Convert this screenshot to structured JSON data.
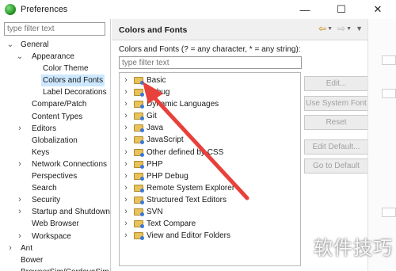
{
  "window": {
    "title": "Preferences",
    "controls": [
      "—",
      "☐",
      "✕"
    ]
  },
  "left": {
    "filter_placeholder": "type filter text",
    "tree": [
      {
        "label": "General",
        "level": 0,
        "state": "expanded"
      },
      {
        "label": "Appearance",
        "level": 1,
        "state": "expanded"
      },
      {
        "label": "Color Theme",
        "level": 2,
        "state": "leaf"
      },
      {
        "label": "Colors and Fonts",
        "level": 2,
        "state": "leaf",
        "selected": true
      },
      {
        "label": "Label Decorations",
        "level": 2,
        "state": "leaf"
      },
      {
        "label": "Compare/Patch",
        "level": 1,
        "state": "leaf"
      },
      {
        "label": "Content Types",
        "level": 1,
        "state": "leaf"
      },
      {
        "label": "Editors",
        "level": 1,
        "state": "collapsed"
      },
      {
        "label": "Globalization",
        "level": 1,
        "state": "leaf"
      },
      {
        "label": "Keys",
        "level": 1,
        "state": "leaf"
      },
      {
        "label": "Network Connections",
        "level": 1,
        "state": "collapsed"
      },
      {
        "label": "Perspectives",
        "level": 1,
        "state": "leaf"
      },
      {
        "label": "Search",
        "level": 1,
        "state": "leaf"
      },
      {
        "label": "Security",
        "level": 1,
        "state": "collapsed"
      },
      {
        "label": "Startup and Shutdown",
        "level": 1,
        "state": "collapsed"
      },
      {
        "label": "Web Browser",
        "level": 1,
        "state": "leaf"
      },
      {
        "label": "Workspace",
        "level": 1,
        "state": "collapsed"
      },
      {
        "label": "Ant",
        "level": 0,
        "state": "collapsed"
      },
      {
        "label": "Bower",
        "level": 0,
        "state": "leaf"
      },
      {
        "label": "BrowserSim/CordovaSim",
        "level": 0,
        "state": "leaf"
      }
    ]
  },
  "right": {
    "title": "Colors and Fonts",
    "description": "Colors and Fonts (? = any character, * = any string):",
    "filter_placeholder": "type filter text",
    "items": [
      "Basic",
      "Debug",
      "Dynamic Languages",
      "Git",
      "Java",
      "JavaScript",
      "Other defined by CSS",
      "PHP",
      "PHP Debug",
      "Remote System Explorer",
      "Structured Text Editors",
      "SVN",
      "Text Compare",
      "View and Editor Folders"
    ],
    "buttons": {
      "edit": "Edit...",
      "use_system_font": "Use System Font",
      "reset": "Reset",
      "edit_default": "Edit Default...",
      "go_to_default": "Go to Default"
    }
  },
  "watermark": "软件技巧",
  "colors": {
    "selection": "#cde8ff",
    "annotation_arrow": "#e8403a",
    "nav_arrow": "#c8860a"
  }
}
